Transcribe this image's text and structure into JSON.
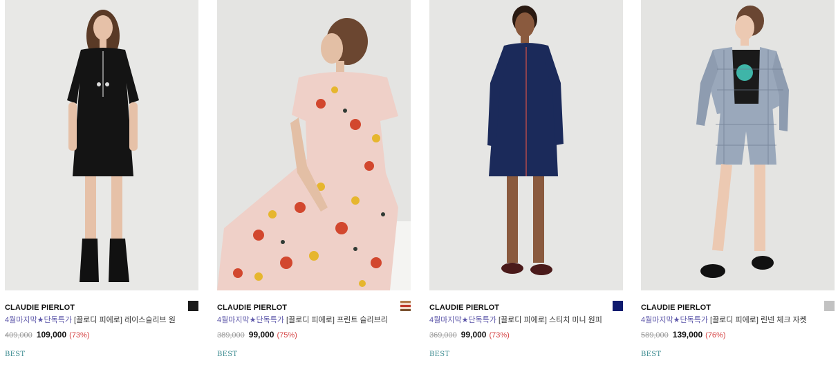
{
  "products": [
    {
      "brand": "CLAUDIE PIERLOT",
      "title_promo": "4월마지막★단독특가",
      "title_rest": " [끌로디 피에로] 레이스슬리브 원",
      "original_price": "409,000",
      "sale_price": "109,000",
      "discount": "(73%)",
      "badge": "BEST",
      "swatch_color": "#1a1a1a",
      "image_desc": "model in black lace-sleeve mini dress"
    },
    {
      "brand": "CLAUDIE PIERLOT",
      "title_promo": "4월마지막★단독특가",
      "title_rest": " [끌로디 피에로] 프린트 슬리브리",
      "original_price": "389,000",
      "sale_price": "99,000",
      "discount": "(75%)",
      "badge": "BEST",
      "swatch_color": "#b07a4a",
      "image_desc": "seated model in printed pink sleeveless dress"
    },
    {
      "brand": "CLAUDIE PIERLOT",
      "title_promo": "4월마지막★단독특가",
      "title_rest": " [끌로디 피에로] 스티치 미니 원피",
      "original_price": "369,000",
      "sale_price": "99,000",
      "discount": "(73%)",
      "badge": "BEST",
      "swatch_color": "#0f1a6e",
      "image_desc": "model in navy stitched mini shirt dress"
    },
    {
      "brand": "CLAUDIE PIERLOT",
      "title_promo": "4월마지막★단독특가",
      "title_rest": " [끌로디 피에로] 린넨 체크 자켓",
      "original_price": "589,000",
      "sale_price": "139,000",
      "discount": "(76%)",
      "badge": "BEST",
      "swatch_color": "#c2c2c2",
      "image_desc": "model in grey check linen jacket and shorts"
    }
  ]
}
